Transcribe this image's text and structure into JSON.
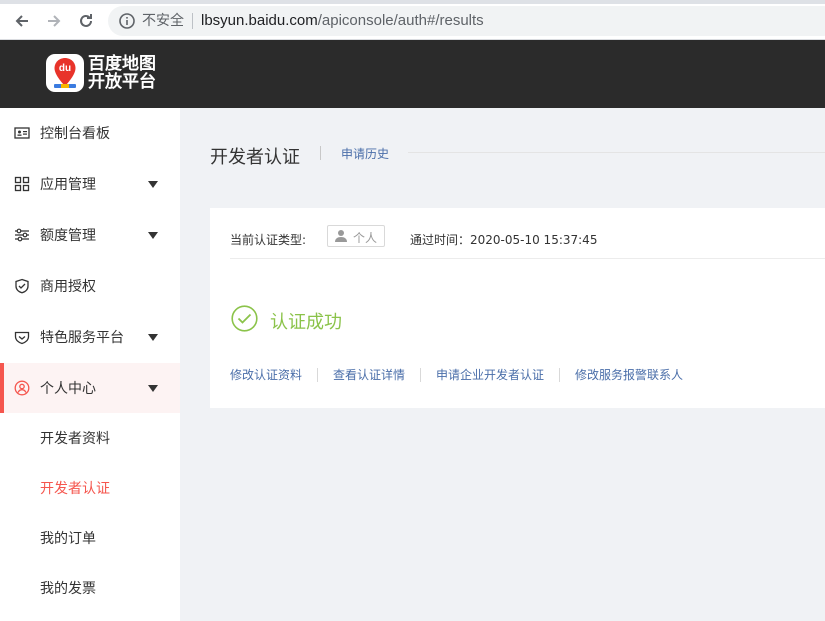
{
  "browser": {
    "security_label": "不安全",
    "url_host": "lbsyun.baidu.com",
    "url_path": "/apiconsole/auth#/results"
  },
  "header": {
    "logo_badge": "du",
    "logo_line1": "百度地图",
    "logo_line2": "开放平台"
  },
  "sidebar": {
    "items": [
      {
        "label": "控制台看板",
        "icon": "id-card-icon"
      },
      {
        "label": "应用管理",
        "icon": "grid-icon"
      },
      {
        "label": "额度管理",
        "icon": "sliders-icon"
      },
      {
        "label": "商用授权",
        "icon": "shield-check-icon"
      },
      {
        "label": "特色服务平台",
        "icon": "heart-shield-icon"
      },
      {
        "label": "个人中心",
        "icon": "user-circle-icon"
      }
    ],
    "sub_items": [
      {
        "label": "开发者资料"
      },
      {
        "label": "开发者认证"
      },
      {
        "label": "我的订单"
      },
      {
        "label": "我的发票"
      }
    ]
  },
  "main": {
    "title": "开发者认证",
    "history_link": "申请历史",
    "auth_type_label": "当前认证类型:",
    "auth_type_value": "个人",
    "pass_time": "通过时间：2020-05-10 15:37:45",
    "status_text": "认证成功",
    "actions": [
      "修改认证资料",
      "查看认证详情",
      "申请企业开发者认证",
      "修改服务报警联系人"
    ]
  },
  "colors": {
    "accent": "#f5564e",
    "link": "#4a6ea9",
    "success": "#8bc34a",
    "header_bg": "#2b2b2b"
  }
}
